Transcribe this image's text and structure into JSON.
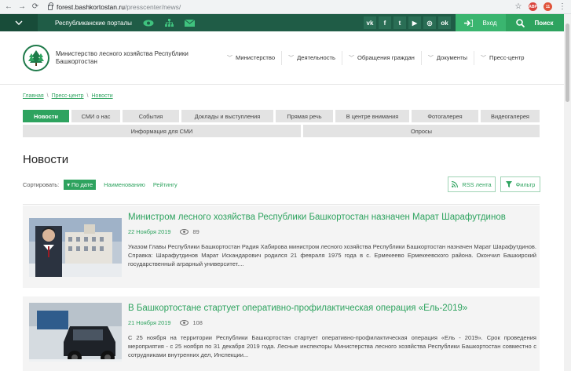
{
  "browser": {
    "url_domain": "forest.bashkortostan.ru",
    "url_path": "/presscenter/news/",
    "back": "←",
    "forward": "→",
    "reload": "⟳",
    "star": "☆",
    "ext1": "ABP",
    "ext2": "11",
    "menu": "⋮"
  },
  "topbar": {
    "portals_label": "Республиканские порталы",
    "socials": [
      "vk",
      "f",
      "t",
      "▶",
      "◎",
      "ok"
    ],
    "login_label": "Вход",
    "search_label": "Поиск"
  },
  "header": {
    "site_name": "Министерство лесного хозяйства Республики Башкортостан",
    "nav": [
      "Министерство",
      "Деятельность",
      "Обращения граждан",
      "Документы",
      "Пресс-центр"
    ]
  },
  "breadcrumb": {
    "items": [
      "Главная",
      "Пресс-центр",
      "Новости"
    ],
    "sep": "\\"
  },
  "tabs": {
    "row1": [
      "Новости",
      "СМИ о нас",
      "События",
      "Доклады и выступления",
      "Прямая речь",
      "В центре внимания",
      "Фотогалерея",
      "Видеогалерея"
    ],
    "row2": [
      "Информация для СМИ",
      "Опросы"
    ],
    "active_index": 0
  },
  "page": {
    "title": "Новости",
    "sort_label": "Сортировать:",
    "sort_options": [
      "По дате",
      "Наименованию",
      "Рейтингу"
    ],
    "rss_label": "RSS лента",
    "filter_label": "Фильтр"
  },
  "news": [
    {
      "title": "Министром лесного хозяйства Республики Башкортостан назначен Марат Шарафутдинов",
      "date": "22 Ноября 2019",
      "views": "89",
      "text": "Указом Главы Республики Башкортостан Радия Хабирова министром лесного хозяйства Республики Башкортостан назначен Марат Шарафутдинов. Справка: Шарафутдинов Марат Искандарович родился 21 февраля 1975 года в с. Ермекеево Ермекеевского района. Окончил Башкирский государственный аграрный университет...."
    },
    {
      "title": "В Башкортостане стартует оперативно-профилактическая операция «Ель-2019»",
      "date": "21 Ноября 2019",
      "views": "108",
      "text": "С 25 ноября на территории Республики Башкортостан стартует оперативно-профилактическая операция «Ель - 2019». Срок проведения мероприятия - с 25 ноября по 31 декабря 2019 года. Лесные инспекторы Министерства лесного хозяйства Республики Башкортостан совместно с сотрудниками внутренних дел, Инспекции..."
    }
  ],
  "colors": {
    "brand_green": "#2ea35f",
    "topbar": "#1f5c46",
    "tab_bg": "#e3e3e3"
  }
}
